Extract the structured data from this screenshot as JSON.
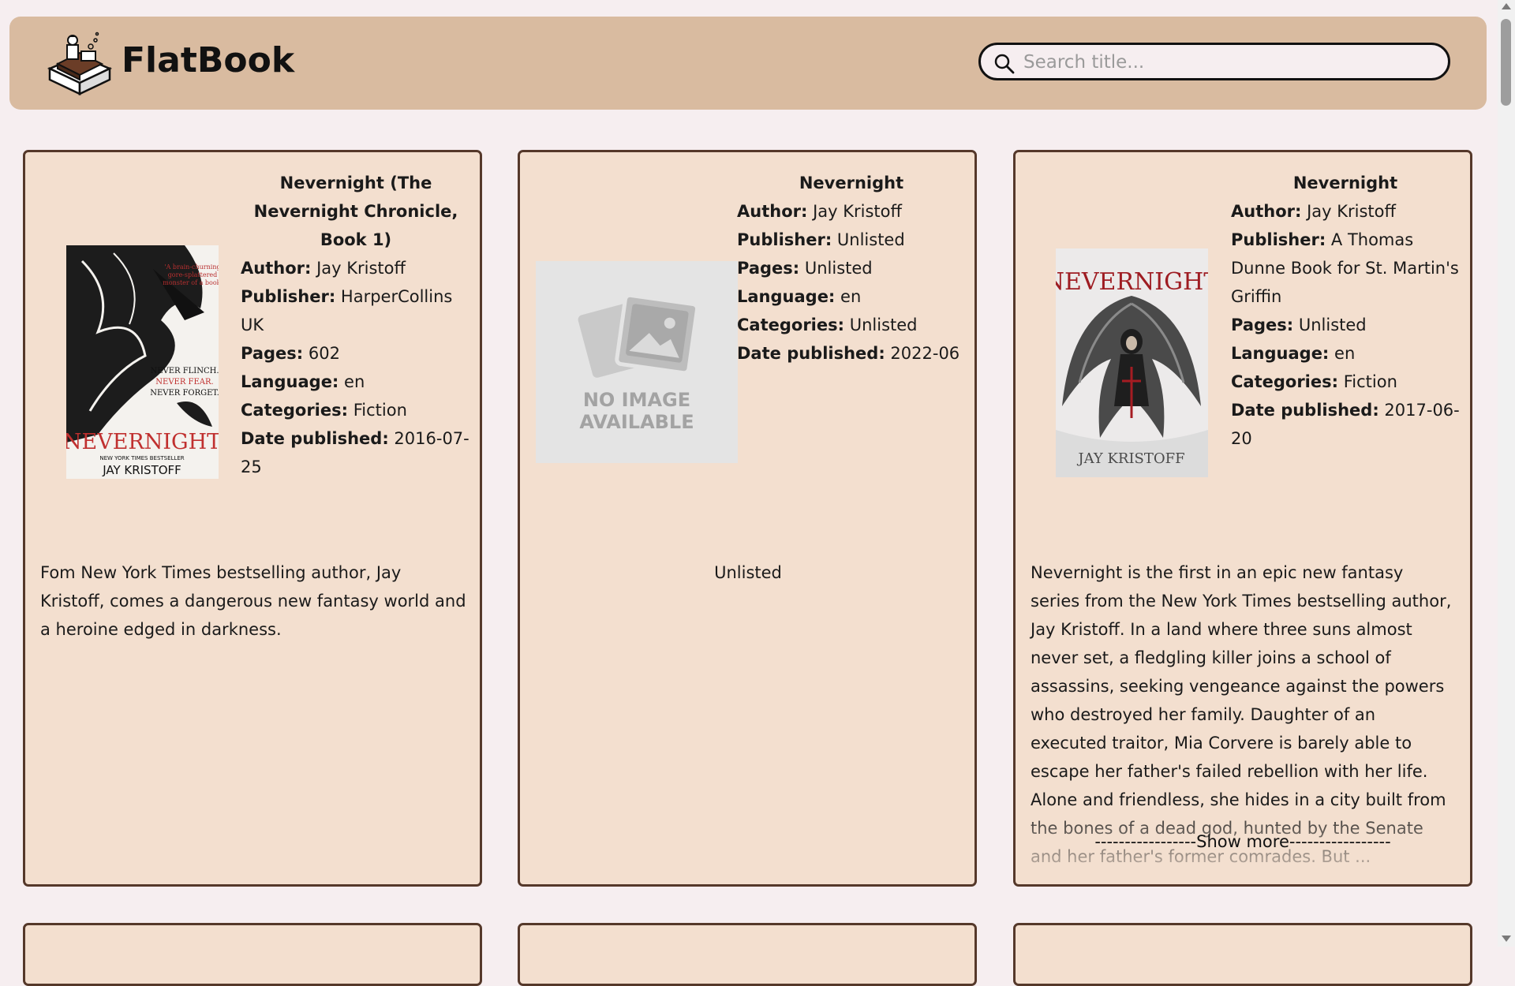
{
  "app": {
    "brand": "FlatBook",
    "colors": {
      "header_bg": "#d9bba0",
      "card_bg": "#f3dfcf",
      "card_border": "#55382a",
      "page_bg": "#f6eef0"
    }
  },
  "search": {
    "placeholder": "Search title..."
  },
  "books": [
    {
      "title": "Nevernight (The Nevernight Chronicle, Book 1)",
      "author_label": "Author:",
      "author": "Jay Kristoff",
      "publisher_label": "Publisher:",
      "publisher": "HarperCollins UK",
      "pages_label": "Pages:",
      "pages": "602",
      "language_label": "Language:",
      "language": "en",
      "categories_label": "Categories:",
      "categories": "Fiction",
      "date_label": "Date published:",
      "date": "2016-07-25",
      "description": "Fom New York Times bestselling author, Jay Kristoff, comes a dangerous new fantasy world and a heroine edged in darkness.",
      "cover_title": "NEVERNIGHT",
      "cover_author": "JAY KRISTOFF",
      "cover_tagline": [
        "NEVER FLINCH.",
        "NEVER FEAR.",
        "NEVER FORGET."
      ],
      "cover_blurb": "NEW YORK TIMES BESTSELLER"
    },
    {
      "title": "Nevernight",
      "author_label": "Author:",
      "author": "Jay Kristoff",
      "publisher_label": "Publisher:",
      "publisher": "Unlisted",
      "pages_label": "Pages:",
      "pages": "Unlisted",
      "language_label": "Language:",
      "language": "en",
      "categories_label": "Categories:",
      "categories": "Unlisted",
      "date_label": "Date published:",
      "date": "2022-06",
      "description": "Unlisted",
      "cover_placeholder": [
        "NO IMAGE",
        "AVAILABLE"
      ]
    },
    {
      "title": "Nevernight",
      "author_label": "Author:",
      "author": "Jay Kristoff",
      "publisher_label": "Publisher:",
      "publisher": "A Thomas Dunne Book for St. Martin's Griffin",
      "pages_label": "Pages:",
      "pages": "Unlisted",
      "language_label": "Language:",
      "language": "en",
      "categories_label": "Categories:",
      "categories": "Fiction",
      "date_label": "Date published:",
      "date": "2017-06-20",
      "description": "Nevernight is the first in an epic new fantasy series from the New York Times bestselling author, Jay Kristoff. In a land where three suns almost never set, a fledgling killer joins a school of assassins, seeking vengeance against the powers who destroyed her family. Daughter of an executed traitor, Mia Corvere is barely able to escape her father's failed rebellion with her life. Alone and friendless, she hides in a city built from the bones of a dead god, hunted by the Senate and her father's former comrades. But ...",
      "cover_title": "NEVERNIGHT",
      "cover_author": "JAY KRISTOFF",
      "show_more": "-----------------Show more-----------------"
    }
  ]
}
